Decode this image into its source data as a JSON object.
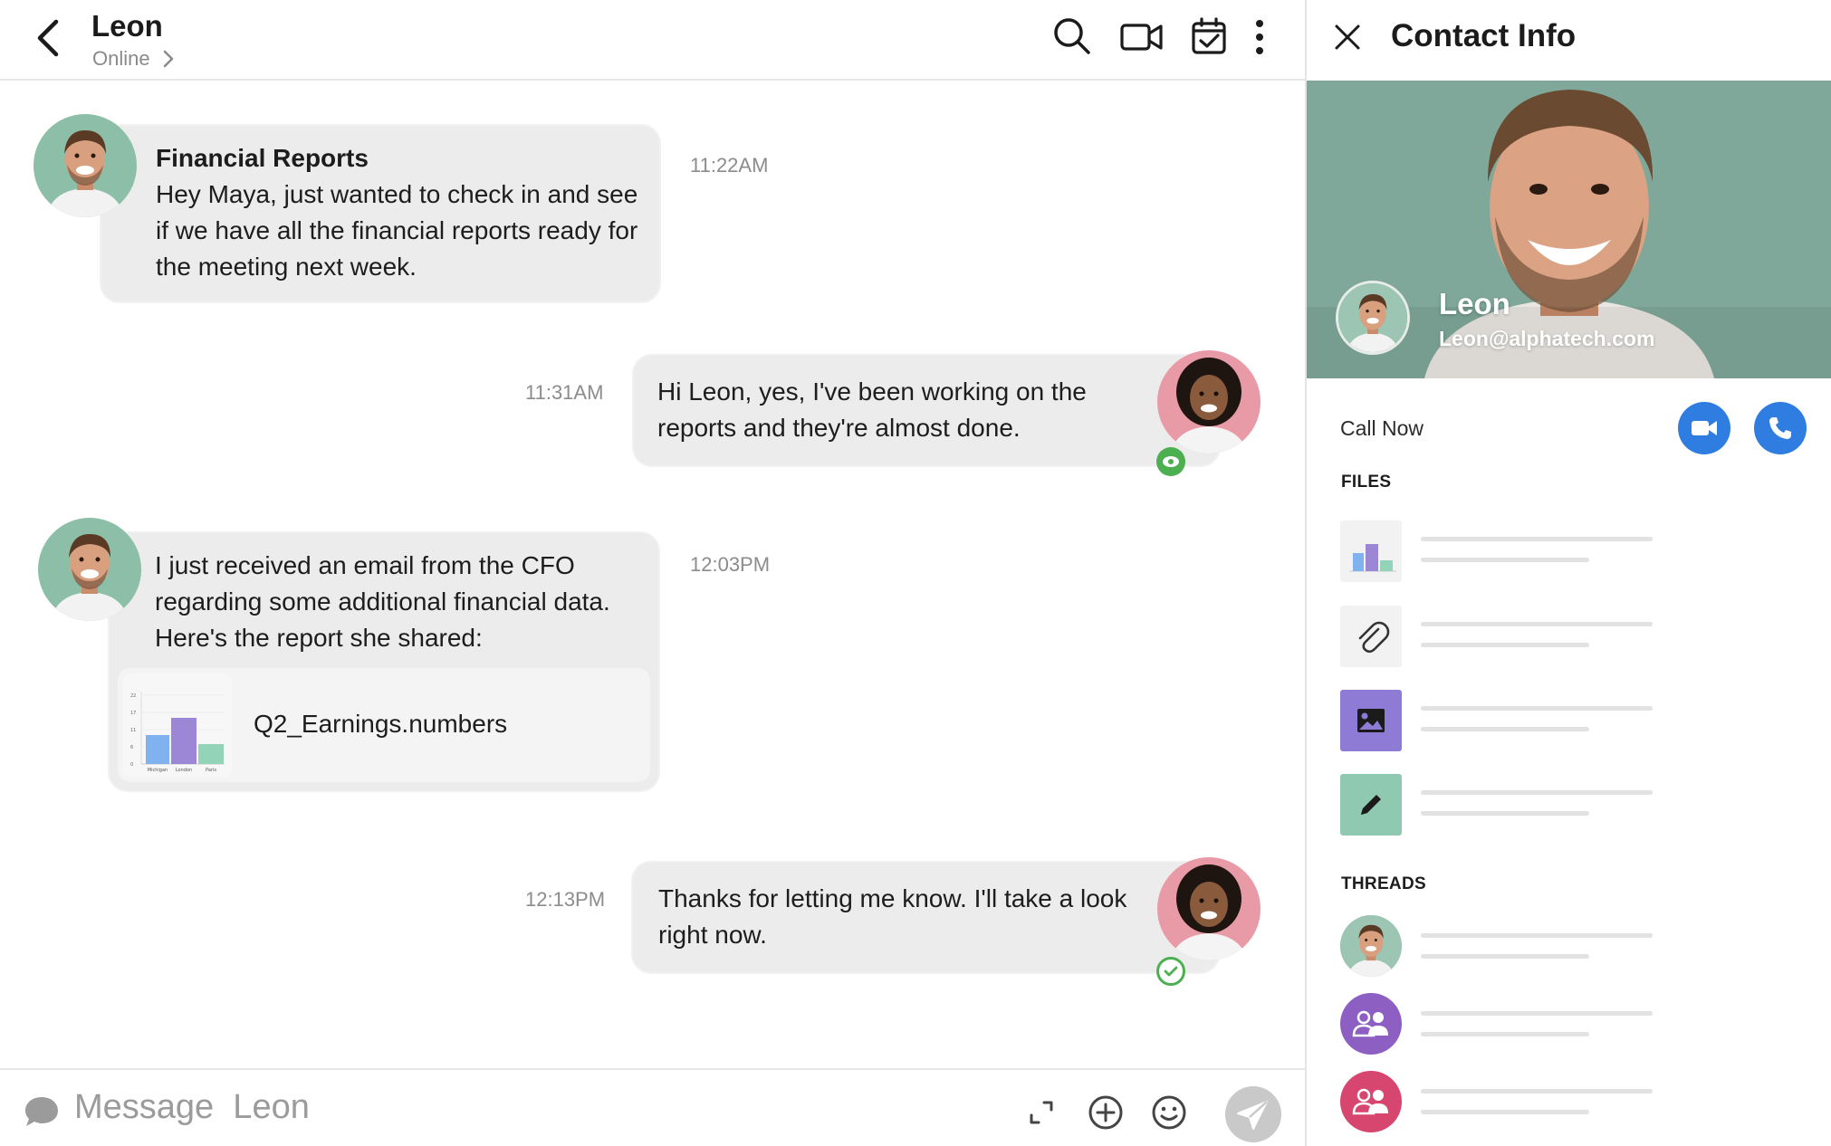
{
  "header": {
    "contact_name": "Leon",
    "status": "Online"
  },
  "messages": [
    {
      "sender": "Leon",
      "title": "Financial Reports",
      "text": "Hey Maya, just wanted to check in and see if we have all the financial reports ready for the meeting next week.",
      "time": "11:22AM"
    },
    {
      "sender": "Maya",
      "text": "Hi Leon, yes, I've been working on the reports and they're almost done.",
      "time": "11:31AM",
      "receipt": "seen"
    },
    {
      "sender": "Leon",
      "text": "I just received an email from the CFO regarding some additional financial data. Here's the report she shared:",
      "time": "12:03PM",
      "attachment": {
        "filename": "Q2_Earnings.numbers",
        "thumb_categories": [
          "Michigan",
          "London",
          "Paris"
        ],
        "thumb_ticks": [
          "22",
          "17",
          "11",
          "6",
          "0"
        ]
      }
    },
    {
      "sender": "Maya",
      "text": "Thanks for letting me know. I'll take a look right now.",
      "time": "12:13PM",
      "receipt": "delivered"
    }
  ],
  "composer": {
    "placeholder": "Message  Leon"
  },
  "contact_info": {
    "title": "Contact Info",
    "name": "Leon",
    "email": "Leon@alphatech.com",
    "call_label": "Call Now",
    "files_label": "FILES",
    "threads_label": "THREADS",
    "files": [
      {
        "kind": "chart",
        "icon": "bar-chart-icon"
      },
      {
        "kind": "attachment",
        "icon": "paperclip-icon"
      },
      {
        "kind": "image",
        "icon": "image-icon",
        "color": "#8e7bd6"
      },
      {
        "kind": "note",
        "icon": "pencil-icon",
        "color": "#8fc9b1"
      }
    ],
    "threads": [
      {
        "kind": "person",
        "icon": "leon-avatar"
      },
      {
        "kind": "group",
        "icon": "group-icon",
        "color": "#8d5fc3"
      },
      {
        "kind": "group",
        "icon": "group-icon",
        "color": "#d6466e"
      }
    ]
  },
  "colors": {
    "accent_blue": "#2f7de1",
    "receipt_green": "#4caf50",
    "bubble_gray": "#ececec",
    "hero_bg": "#7fa79a"
  }
}
